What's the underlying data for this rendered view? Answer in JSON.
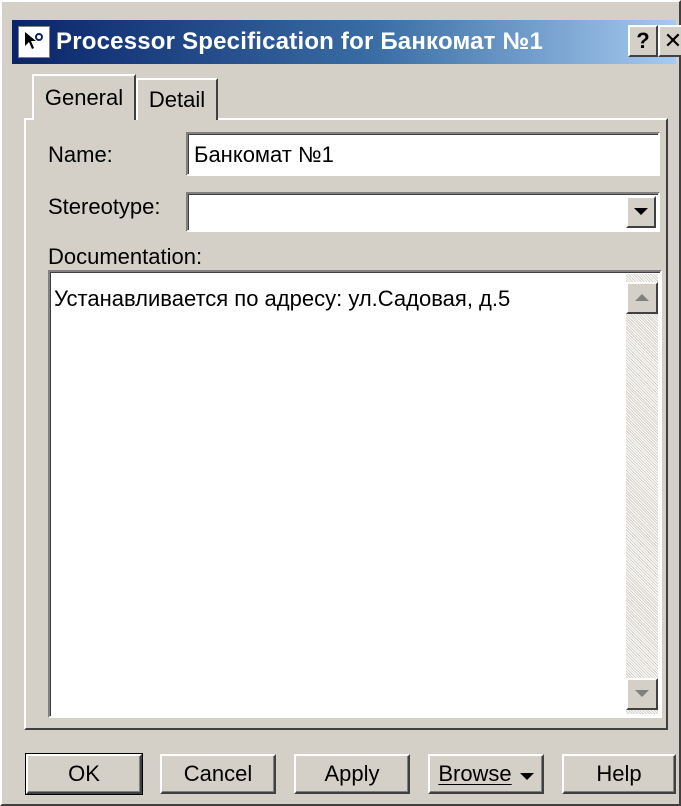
{
  "window": {
    "title": "Processor Specification for Банкомат №1",
    "help_glyph": "?",
    "close_glyph": "✕",
    "app_icon": "magnifier-cursor-icon"
  },
  "tabs": [
    {
      "label": "General",
      "selected": true
    },
    {
      "label": "Detail",
      "selected": false
    }
  ],
  "form": {
    "name_label": "Name:",
    "name_value": "Банкомат №1",
    "stereotype_label": "Stereotype:",
    "stereotype_value": "",
    "documentation_label": "Documentation:",
    "documentation_value": "Устанавливается по адресу: ул.Садовая, д.5"
  },
  "buttons": {
    "ok": "OK",
    "cancel": "Cancel",
    "apply": "Apply",
    "browse": "Browse",
    "help": "Help"
  },
  "colors": {
    "titlebar_start": "#0a246a",
    "titlebar_end": "#a6caf0",
    "face": "#d4d0c8"
  }
}
